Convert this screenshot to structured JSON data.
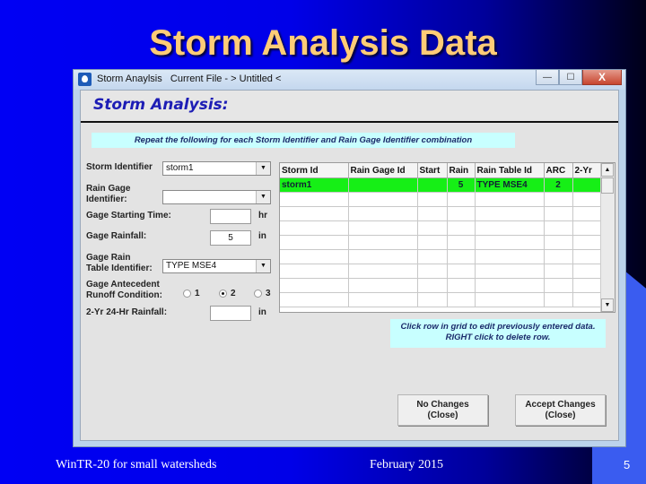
{
  "slide": {
    "title": "Storm Analysis Data",
    "footer_left": "WinTR-20 for small watersheds",
    "footer_center": "February 2015",
    "page_number": "5"
  },
  "window": {
    "title": "Storm Anaylsis   Current File - > Untitled <",
    "app_icon": "water-drop-icon",
    "controls": {
      "minimize": "—",
      "maximize": "☐",
      "close": "X"
    }
  },
  "form": {
    "header": "Storm Analysis:",
    "instruction": "Repeat the following for each Storm Identifier and Rain Gage Identifier combination",
    "storm_identifier": {
      "label": "Storm Identifier",
      "value": "storm1"
    },
    "rain_gage_identifier": {
      "label_line1": "Rain Gage",
      "label_line2": "Identifier:",
      "value": ""
    },
    "gage_starting_time": {
      "label": "Gage Starting Time:",
      "value": "",
      "unit": "hr"
    },
    "gage_rainfall": {
      "label": "Gage Rainfall:",
      "value": "5",
      "unit": "in"
    },
    "gage_rain_table": {
      "label_line1": "Gage Rain",
      "label_line2": "Table Identifier:",
      "value": "TYPE MSE4"
    },
    "arc": {
      "label_line1": "Gage Antecedent",
      "label_line2": "Runoff Condition:",
      "options": [
        "1",
        "2",
        "3"
      ],
      "selected": "2"
    },
    "two_yr_rainfall": {
      "label": "2-Yr 24-Hr Rainfall:",
      "value": "",
      "unit": "in"
    }
  },
  "grid": {
    "columns": [
      "Storm Id",
      "Rain Gage Id",
      "Start",
      "Rain",
      "Rain Table Id",
      "ARC",
      "2-Yr"
    ],
    "rows": [
      [
        "storm1",
        "",
        "",
        "5",
        "TYPE MSE4",
        "2",
        ""
      ],
      [
        "",
        "",
        "",
        "",
        "",
        "",
        ""
      ],
      [
        "",
        "",
        "",
        "",
        "",
        "",
        ""
      ],
      [
        "",
        "",
        "",
        "",
        "",
        "",
        ""
      ],
      [
        "",
        "",
        "",
        "",
        "",
        "",
        ""
      ],
      [
        "",
        "",
        "",
        "",
        "",
        "",
        ""
      ],
      [
        "",
        "",
        "",
        "",
        "",
        "",
        ""
      ],
      [
        "",
        "",
        "",
        "",
        "",
        "",
        ""
      ],
      [
        "",
        "",
        "",
        "",
        "",
        "",
        ""
      ]
    ],
    "selected_row": 0,
    "selected_color": "#16ef16"
  },
  "note": {
    "line1": "Click row in grid to edit previously entered data.",
    "line2": "RIGHT click to delete row."
  },
  "buttons": {
    "no_changes": "No Changes\n(Close)",
    "accept_changes": "Accept Changes\n(Close)"
  }
}
